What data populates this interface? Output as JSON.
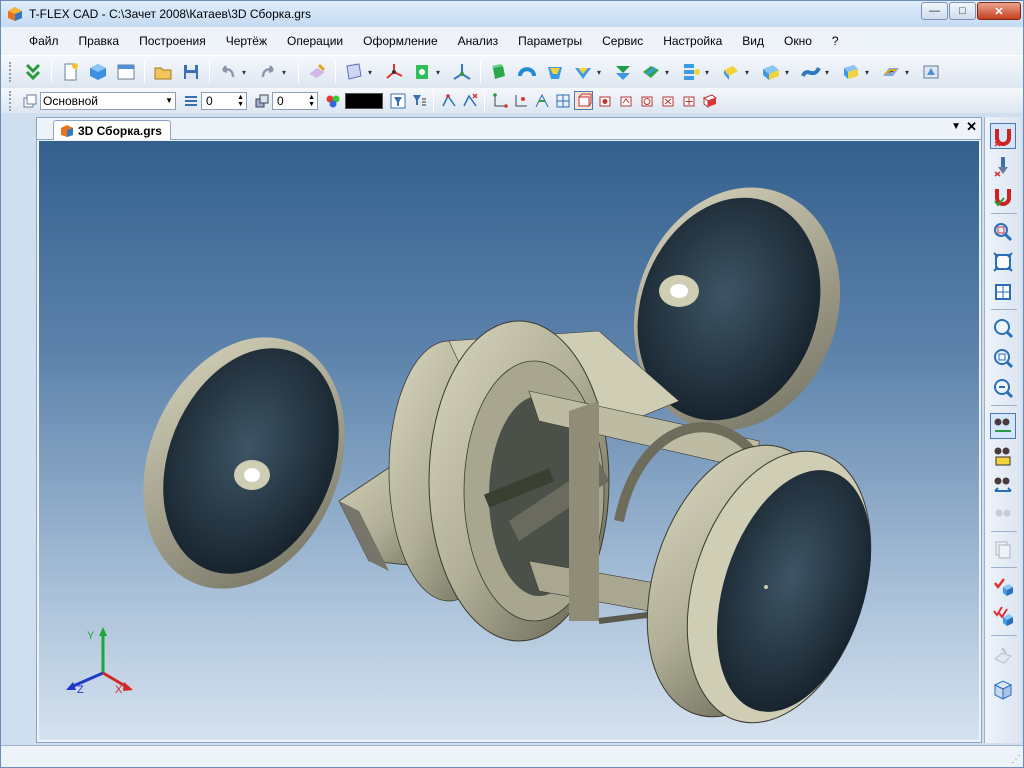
{
  "window": {
    "title": "T-FLEX CAD - C:\\Зачет 2008\\Катаев\\3D Сборка.grs",
    "minimize": "—",
    "maximize": "□",
    "close": "✕"
  },
  "menu": [
    "Файл",
    "Правка",
    "Построения",
    "Чертёж",
    "Операции",
    "Оформление",
    "Анализ",
    "Параметры",
    "Сервис",
    "Настройка",
    "Вид",
    "Окно",
    "?"
  ],
  "toolbar2": {
    "layer": "Основной",
    "level_value": "0",
    "priority_value": "0",
    "color": "#000000"
  },
  "document": {
    "tab_label": "3D Сборка.grs",
    "tab_menu": "▼",
    "tab_close": "✕"
  },
  "axes": {
    "x": "X",
    "y": "Y",
    "z": "Z"
  },
  "colors": {
    "accent": "#2a6fb7",
    "model_face": "#b5b398",
    "model_dark": "#1d2b36",
    "viewport_top": "#34608e",
    "viewport_bottom": "#d6e2ef"
  }
}
